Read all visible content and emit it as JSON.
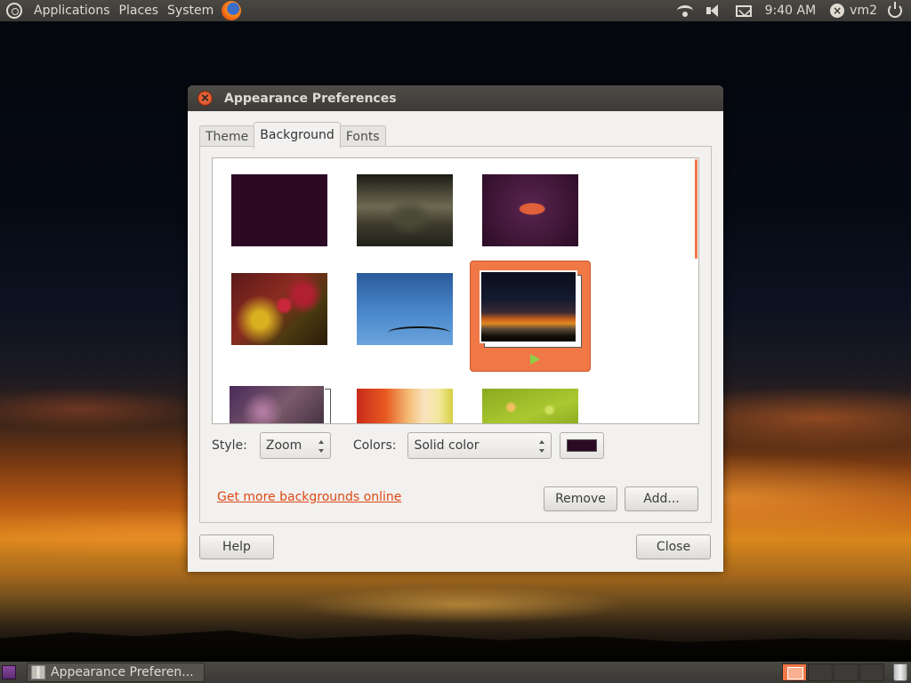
{
  "top_panel": {
    "menus": [
      "Applications",
      "Places",
      "System"
    ],
    "clock": "9:40 AM",
    "user": "vm2"
  },
  "window": {
    "title": "Appearance Preferences",
    "tabs": [
      {
        "label": "Theme",
        "active": false
      },
      {
        "label": "Background",
        "active": true
      },
      {
        "label": "Fonts",
        "active": false
      }
    ],
    "style_label": "Style:",
    "style_value": "Zoom",
    "colors_label": "Colors:",
    "colors_value": "Solid color",
    "selected_color": "#2c0a24",
    "link_text": "Get more backgrounds online",
    "remove_label": "Remove",
    "add_label": "Add...",
    "help_label": "Help",
    "close_label": "Close"
  },
  "taskbar": {
    "task_label": "Appearance Preferen..."
  },
  "colors": {
    "accent": "#f07746",
    "link": "#dd4814",
    "panel": "#3c3b37"
  }
}
